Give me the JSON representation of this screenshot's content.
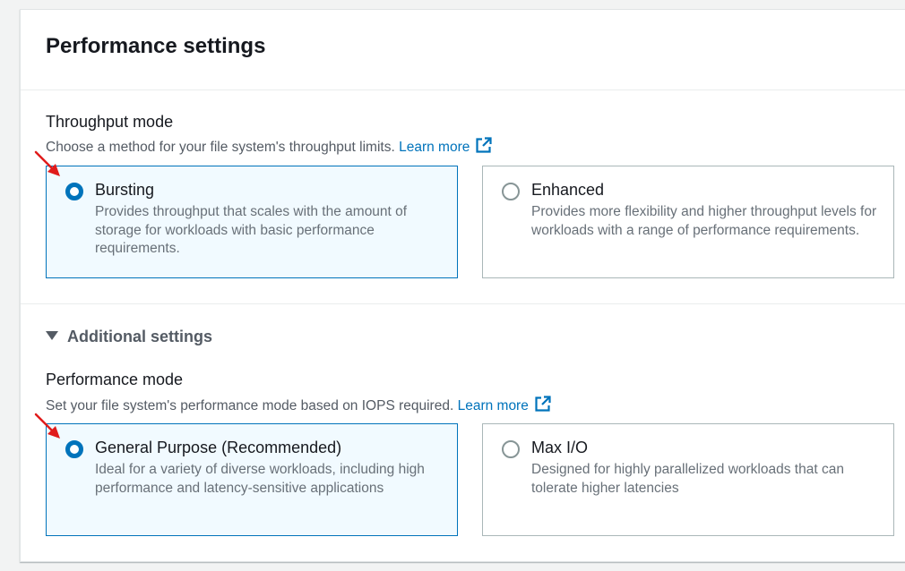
{
  "panel": {
    "title": "Performance settings"
  },
  "throughput": {
    "label": "Throughput mode",
    "description": "Choose a method for your file system's throughput limits.",
    "learn_more": "Learn more",
    "options": [
      {
        "title": "Bursting",
        "description": "Provides throughput that scales with the amount of storage for workloads with basic performance requirements.",
        "selected": true
      },
      {
        "title": "Enhanced",
        "description": "Provides more flexibility and higher throughput levels for workloads with a range of performance requirements.",
        "selected": false
      }
    ]
  },
  "additional": {
    "label": "Additional settings"
  },
  "performance": {
    "label": "Performance mode",
    "description": "Set your file system's performance mode based on IOPS required.",
    "learn_more": "Learn more",
    "options": [
      {
        "title": "General Purpose (Recommended)",
        "description": "Ideal for a variety of diverse workloads, including high performance and latency-sensitive applications",
        "selected": true
      },
      {
        "title": "Max I/O",
        "description": "Designed for highly parallelized workloads that can tolerate higher latencies",
        "selected": false
      }
    ]
  },
  "colors": {
    "accent": "#0073bb",
    "selected_bg": "#f1faff",
    "annotation_arrow": "#e01b1b"
  },
  "icons": {
    "external_link": "external-link-icon",
    "caret": "caret-down-icon",
    "annotation": "red-arrow-icon"
  }
}
